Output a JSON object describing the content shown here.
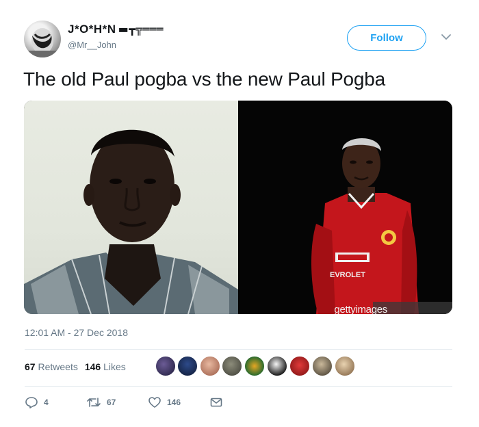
{
  "user": {
    "display_name": "J*O*H*N",
    "name_decoration": "▬┳╦═══",
    "handle": "@Mr__John",
    "avatar_icon": "avatar"
  },
  "follow_label": "Follow",
  "tweet_text": "The old Paul pogba vs the new Paul Pogba",
  "media": {
    "watermark": "gettyimages",
    "right_photo_text": "EVROLET"
  },
  "timestamp": "12:01 AM - 27 Dec 2018",
  "stats": {
    "retweets_count": "67",
    "retweets_label": "Retweets",
    "likes_count": "146",
    "likes_label": "Likes"
  },
  "actions": {
    "reply_count": "4",
    "retweet_count": "67",
    "like_count": "146"
  },
  "colors": {
    "accent": "#1da1f2",
    "secondary_text": "#657786",
    "primary_text": "#14171a"
  }
}
